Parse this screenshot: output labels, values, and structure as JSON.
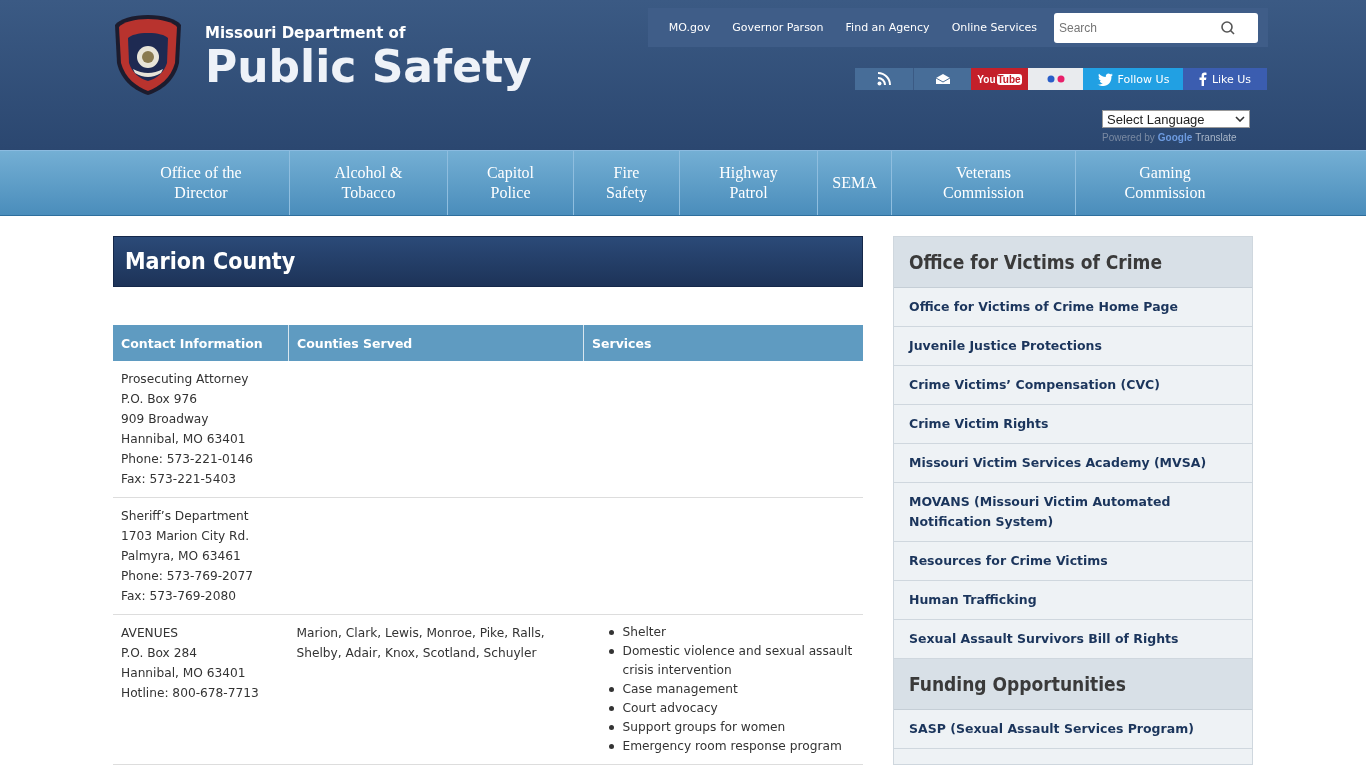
{
  "header": {
    "agency_line": "Missouri Department of",
    "agency_name": "Public Safety",
    "top_links": [
      "MO.gov",
      "Governor Parson",
      "Find an Agency",
      "Online Services"
    ],
    "search": {
      "placeholder": "Search"
    },
    "social": [
      {
        "kind": "rss"
      },
      {
        "kind": "mail"
      },
      {
        "kind": "youtube",
        "label": "You",
        "label_2": "Tube"
      },
      {
        "kind": "flickr"
      },
      {
        "kind": "twitter",
        "label": "Follow Us"
      },
      {
        "kind": "facebook",
        "label": "Like Us"
      }
    ],
    "language": {
      "value": "Select Language",
      "powered_by": "Powered by",
      "brand": "Google",
      "service": "Translate"
    }
  },
  "nav": [
    "Office of the\nDirector",
    "Alcohol &\nTobacco",
    "Capitol\nPolice",
    "Fire\nSafety",
    "Highway\nPatrol",
    "SEMA",
    "Veterans\nCommission",
    "Gaming\nCommission"
  ],
  "page_title": "Marion County",
  "table": {
    "columns": [
      "Contact Information",
      "Counties Served",
      "Services"
    ],
    "rows": [
      {
        "contact": [
          "Prosecuting Attorney",
          "P.O. Box 976",
          "909 Broadway",
          "Hannibal, MO 63401",
          "Phone: 573-221-0146",
          "Fax: 573-221-5403"
        ],
        "counties": "",
        "services": []
      },
      {
        "contact": [
          "Sheriff’s Department",
          "1703 Marion City Rd.",
          "Palmyra, MO 63461",
          "Phone: 573-769-2077",
          "Fax: 573-769-2080"
        ],
        "counties": "",
        "services": []
      },
      {
        "contact": [
          "AVENUES",
          "P.O. Box 284",
          "Hannibal, MO 63401",
          "Hotline: 800-678-7713"
        ],
        "counties": "Marion, Clark, Lewis, Monroe, Pike, Ralls, Shelby, Adair, Knox, Scotland, Schuyler",
        "services": [
          "Shelter",
          "Domestic violence and sexual assault crisis intervention",
          "Case management",
          "Court advocacy",
          "Support groups for women",
          "Emergency room response program"
        ]
      }
    ]
  },
  "sidebar": [
    {
      "title": "Office for Victims of Crime",
      "items": [
        "Office for Victims of Crime Home Page",
        "Juvenile Justice Protections",
        "Crime Victims’ Compensation (CVC)",
        "Crime Victim Rights",
        "Missouri Victim Services Academy (MVSA)",
        "MOVANS (Missouri Victim Automated Notification System)",
        "Resources for Crime Victims",
        "Human Trafficking",
        "Sexual Assault Survivors Bill of Rights"
      ]
    },
    {
      "title": "Funding Opportunities",
      "items": [
        "SASP (Sexual Assault Services Program)"
      ]
    }
  ]
}
